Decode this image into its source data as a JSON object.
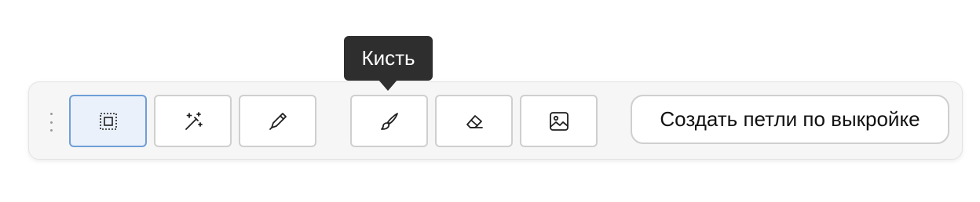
{
  "toolbar": {
    "tools": [
      {
        "name": "select-area",
        "icon": "select-area-icon",
        "active": true
      },
      {
        "name": "magic-wand",
        "icon": "magic-wand-icon",
        "active": false
      },
      {
        "name": "pipette",
        "icon": "pipette-icon",
        "active": false
      },
      {
        "name": "brush",
        "icon": "brush-icon",
        "active": false
      },
      {
        "name": "eraser",
        "icon": "eraser-icon",
        "active": false
      },
      {
        "name": "image",
        "icon": "image-icon",
        "active": false
      }
    ],
    "action_button_label": "Создать петли по выкройке",
    "active_border_color": "#6f9fd8"
  },
  "tooltip": {
    "text": "Кисть"
  }
}
